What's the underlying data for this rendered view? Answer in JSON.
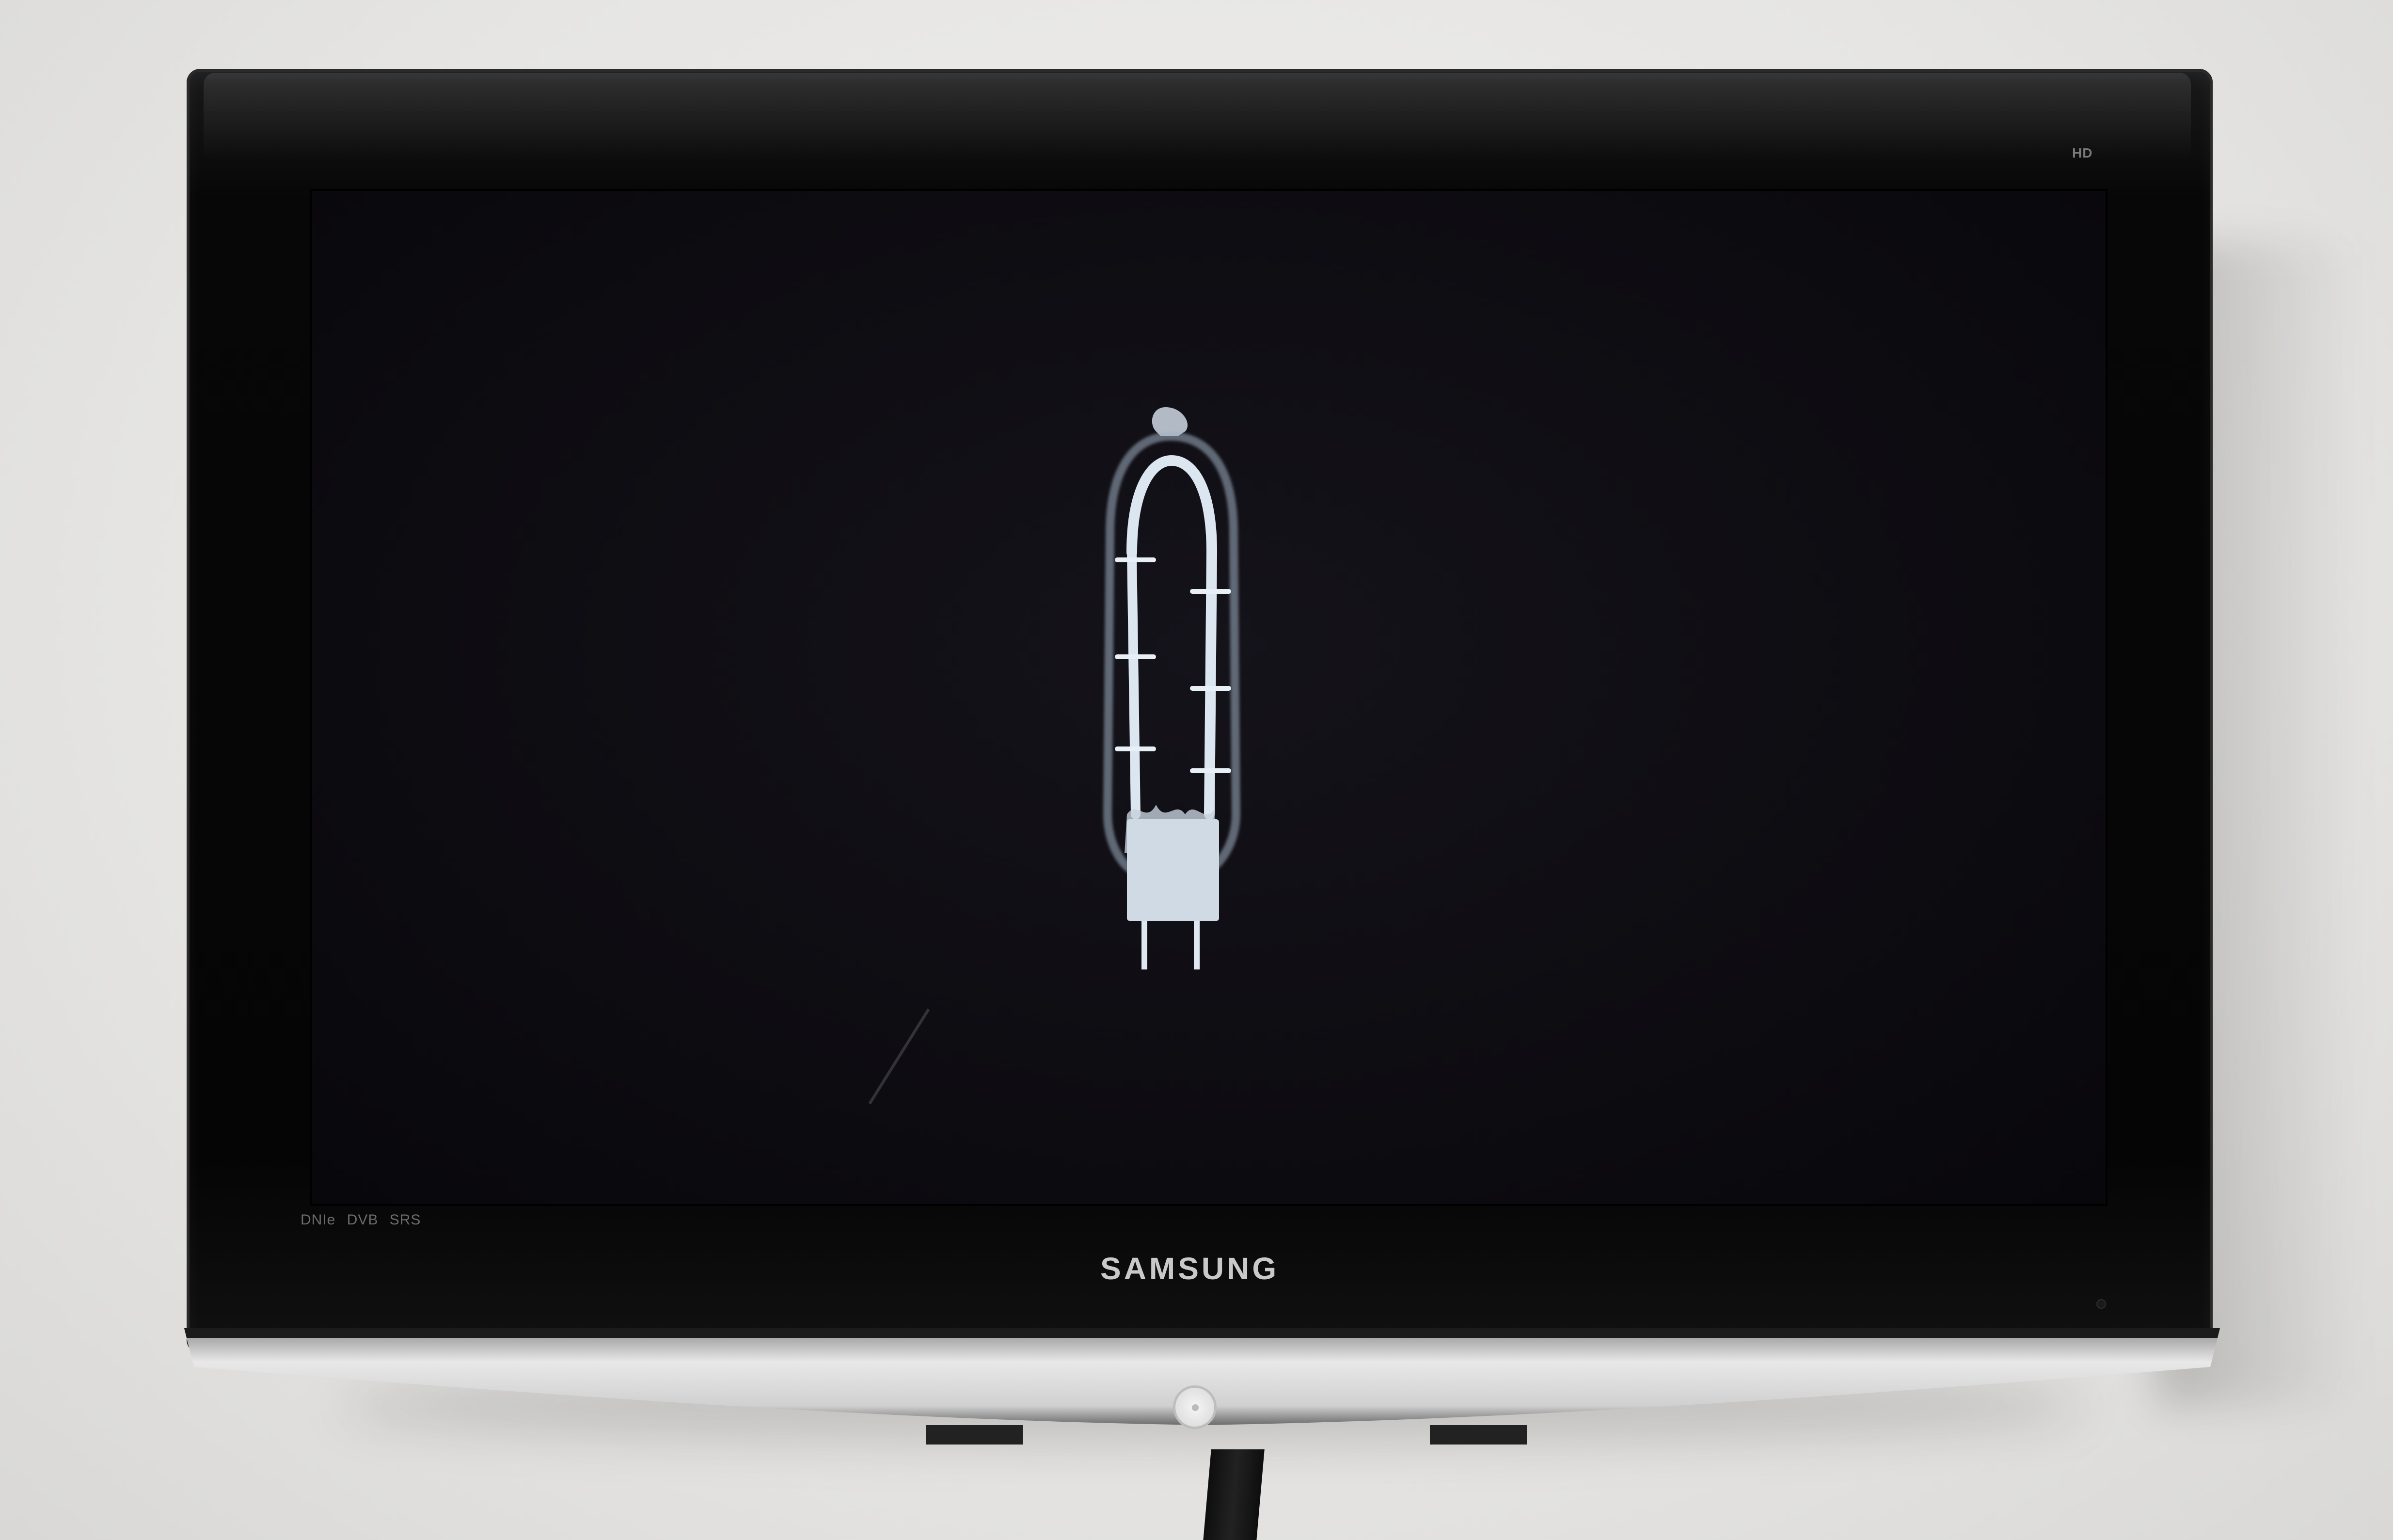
{
  "tv": {
    "brand_label": "SAMSUNG",
    "hd_badge": "HD",
    "feature_badges": [
      "DNIe",
      "DVB",
      "SRS"
    ]
  },
  "screen": {
    "content": "vacuum-tube-image"
  },
  "colors": {
    "wall": "#e9e8e6",
    "bezel": "#050505",
    "screen": "#0c0b10",
    "tube_glow": "#d9e6f2",
    "stand_silver": "#cfcfcf"
  }
}
